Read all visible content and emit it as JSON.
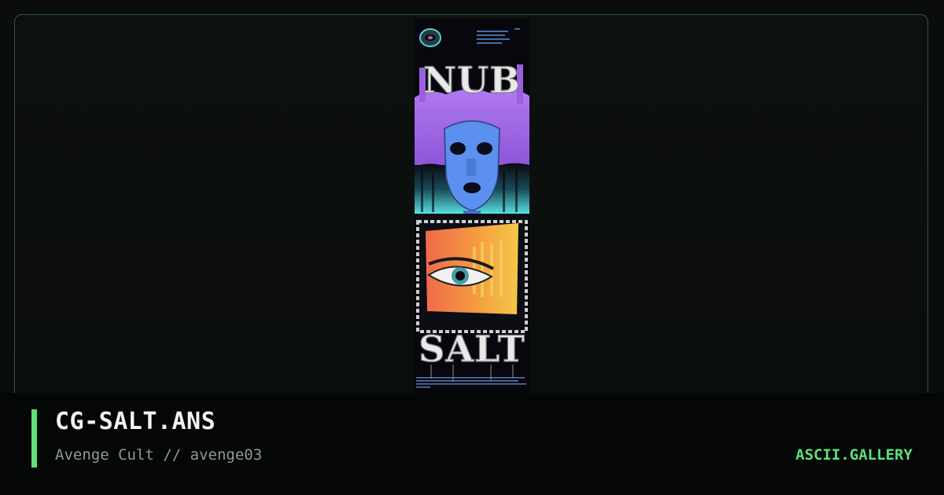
{
  "artwork": {
    "title": "CG-SALT.ANS",
    "group": "Avenge Cult",
    "author": "avenge03",
    "separator": "//",
    "logo_top": "NUB",
    "logo_bottom": "SALT"
  },
  "brand": "ASCII.GALLERY",
  "colors": {
    "accent": "#5ee07a",
    "border": "#2f5a36",
    "background": "#0a0d0b",
    "footer": "#050606"
  }
}
